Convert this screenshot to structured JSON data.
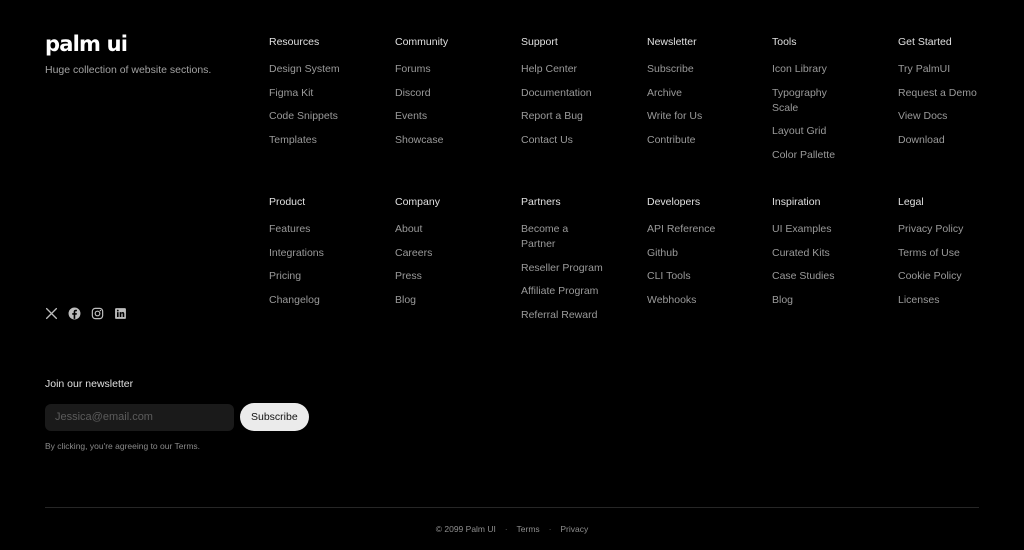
{
  "brand": {
    "logo": "palm ui",
    "tagline": "Huge collection of website sections."
  },
  "social": [
    {
      "icon": "x-icon"
    },
    {
      "icon": "facebook-icon"
    },
    {
      "icon": "instagram-icon"
    },
    {
      "icon": "linkedin-icon"
    }
  ],
  "columns": [
    {
      "title": "Resources",
      "links": [
        "Design System",
        "Figma Kit",
        "Code Snippets",
        "Templates"
      ]
    },
    {
      "title": "Community",
      "links": [
        "Forums",
        "Discord",
        "Events",
        "Showcase"
      ]
    },
    {
      "title": "Support",
      "links": [
        "Help Center",
        "Documentation",
        "Report a Bug",
        "Contact Us"
      ]
    },
    {
      "title": "Newsletter",
      "links": [
        "Subscribe",
        "Archive",
        "Write for Us",
        "Contribute"
      ]
    },
    {
      "title": "Tools",
      "links": [
        "Icon Library",
        "Typography Scale",
        "Layout Grid",
        "Color Pallette"
      ]
    },
    {
      "title": "Get Started",
      "links": [
        "Try PalmUI",
        "Request a Demo",
        "View Docs",
        "Download"
      ]
    },
    {
      "title": "Product",
      "links": [
        "Features",
        "Integrations",
        "Pricing",
        "Changelog"
      ]
    },
    {
      "title": "Company",
      "links": [
        "About",
        "Careers",
        "Press",
        "Blog"
      ]
    },
    {
      "title": "Partners",
      "links": [
        "Become a Partner",
        "Reseller Program",
        "Affiliate Program",
        "Referral Reward"
      ]
    },
    {
      "title": "Developers",
      "links": [
        "API Reference",
        "Github",
        "CLI Tools",
        "Webhooks"
      ]
    },
    {
      "title": "Inspiration",
      "links": [
        "UI Examples",
        "Curated Kits",
        "Case Studies",
        "Blog"
      ]
    },
    {
      "title": "Legal",
      "links": [
        "Privacy Policy",
        "Terms of Use",
        "Cookie Policy",
        "Licenses"
      ]
    }
  ],
  "newsletter": {
    "title": "Join our newsletter",
    "placeholder": "Jessica@email.com",
    "button": "Subscribe",
    "note": "By clicking, you're agreeing to our Terms."
  },
  "footer": {
    "copyright": "© 2099 Palm UI",
    "separator": "·",
    "terms": "Terms",
    "privacy": "Privacy"
  },
  "colors": {
    "background": "#000000",
    "heading": "#e0e0e0",
    "link": "#9a9a9a",
    "button": "#ebebeb"
  }
}
